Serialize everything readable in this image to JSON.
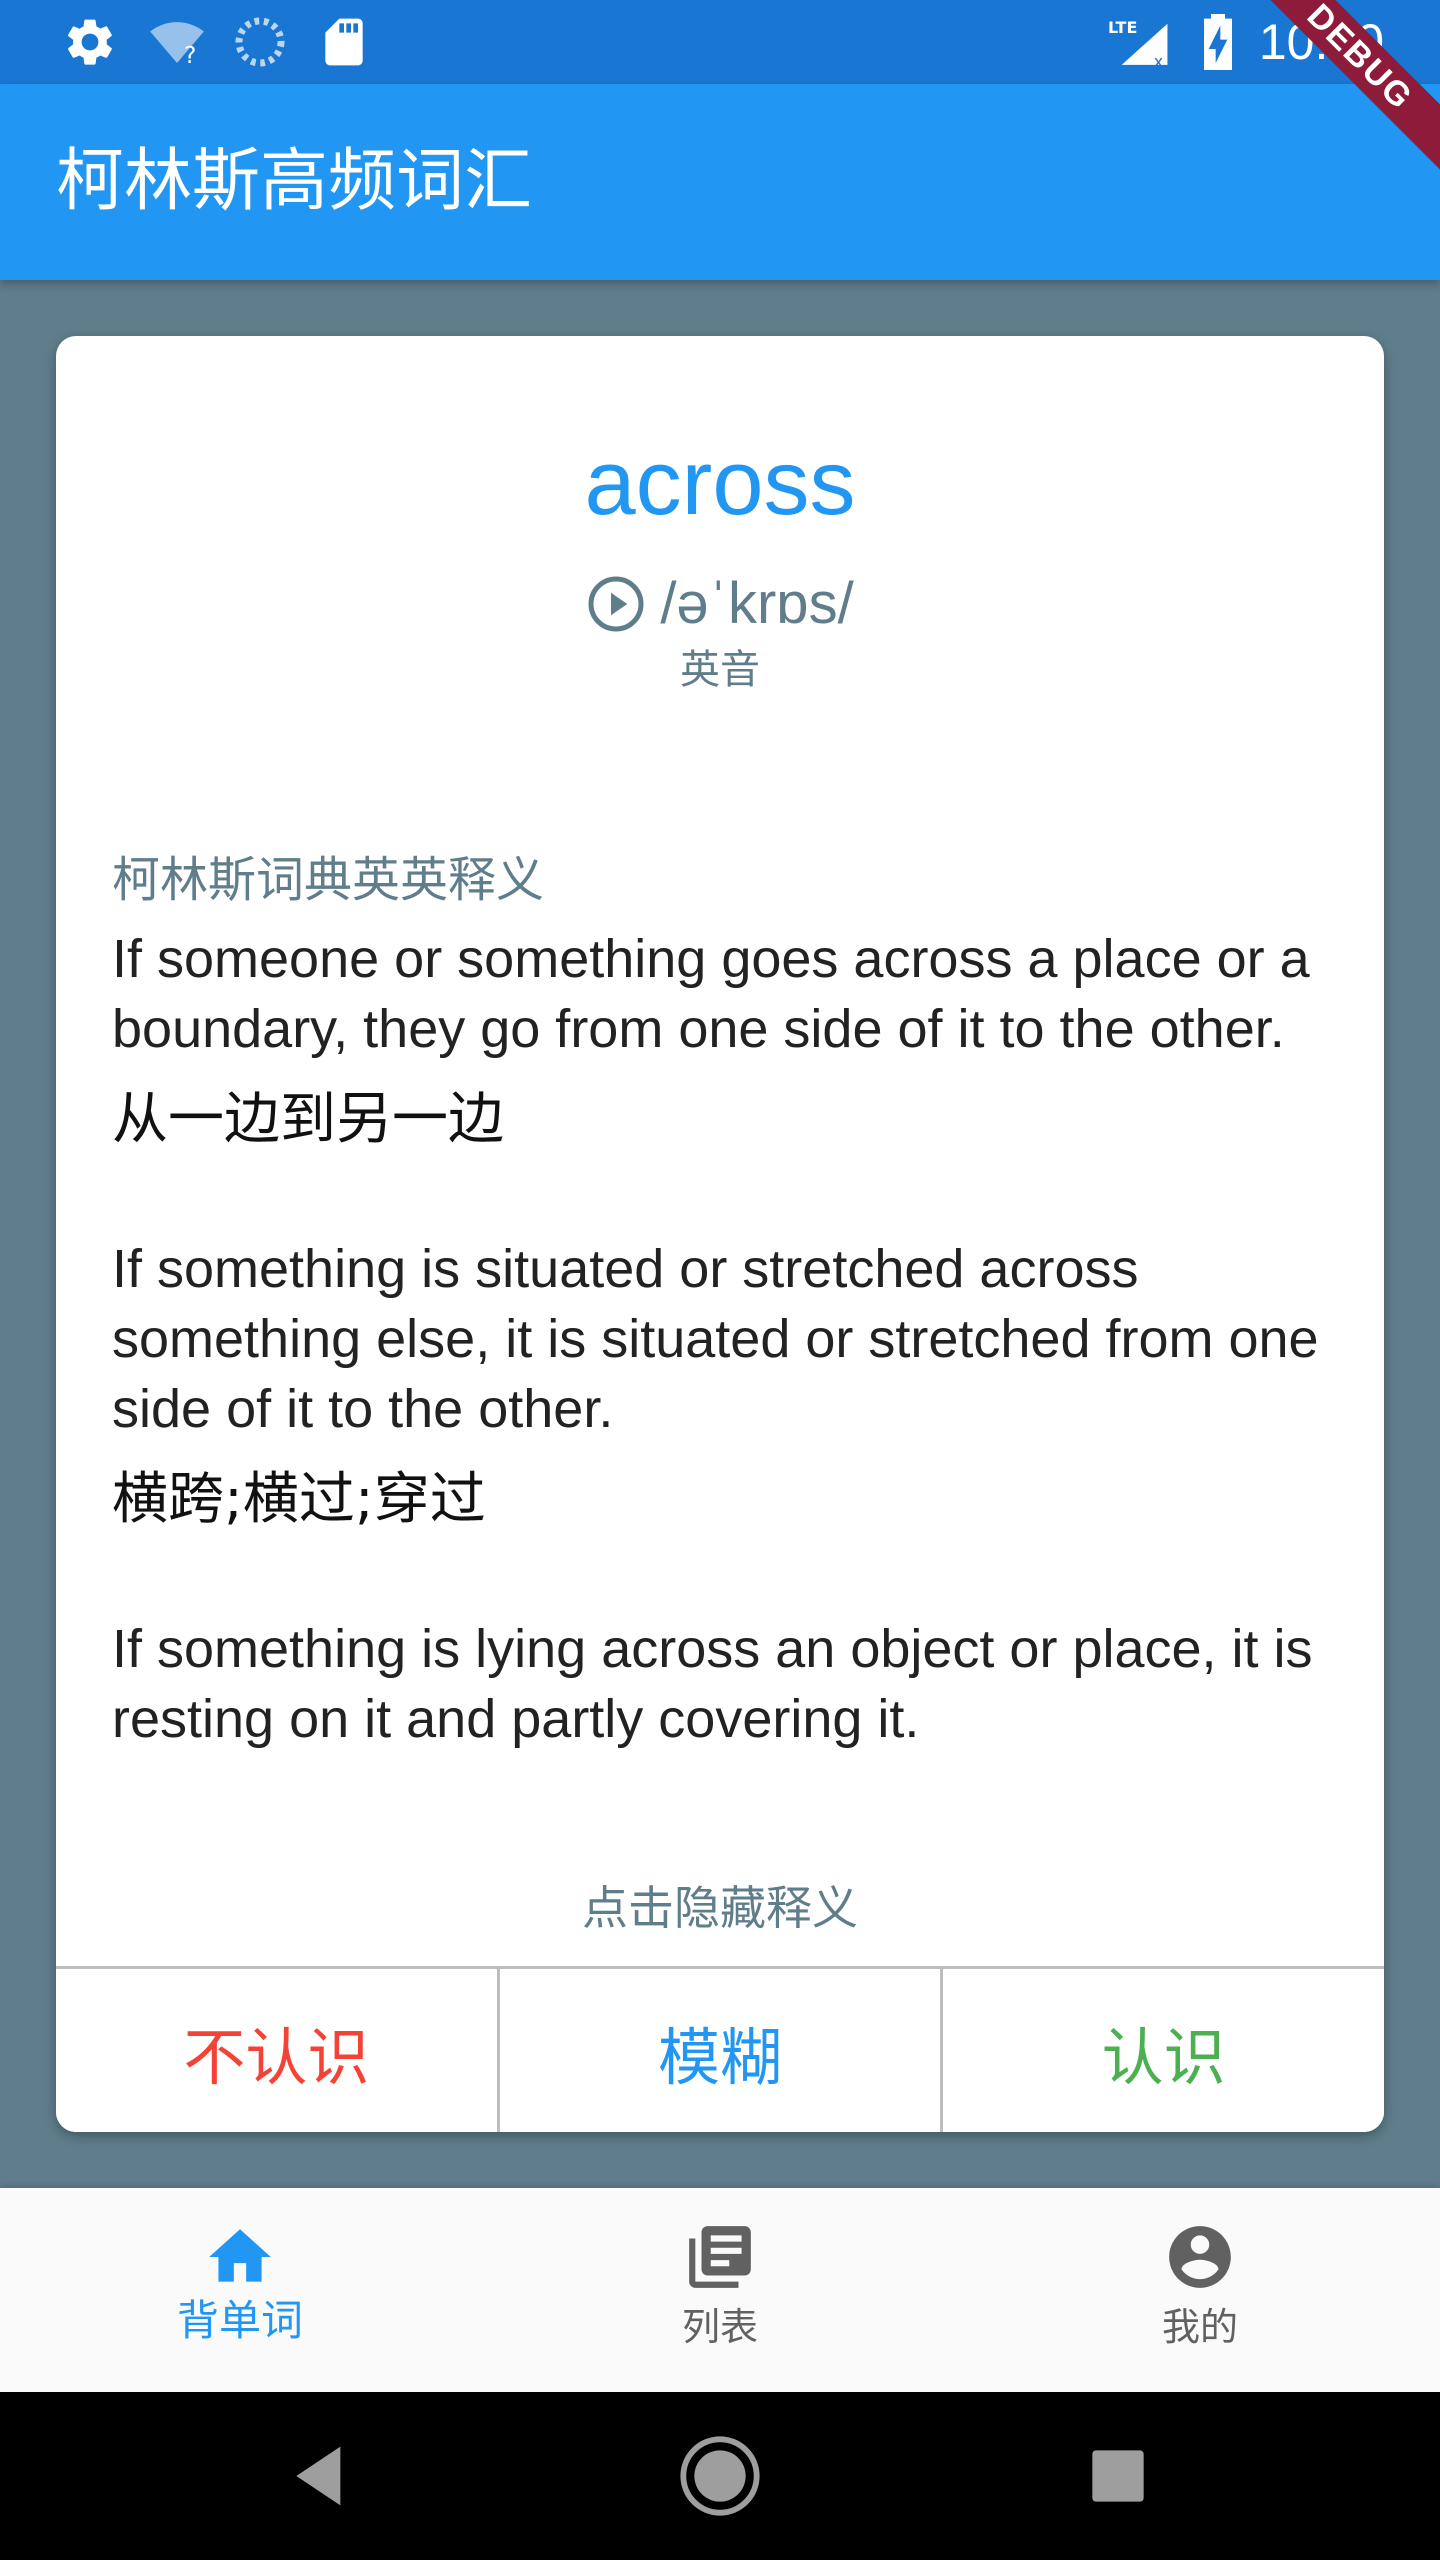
{
  "status_bar": {
    "time": "10:40",
    "icons": [
      "settings-icon",
      "wifi-unknown-icon",
      "loading-icon",
      "sd-card-icon",
      "lte-signal-icon",
      "battery-charging-icon"
    ],
    "color": "#1976D2"
  },
  "debug_banner": "DEBUG",
  "app_bar": {
    "title": "柯林斯高频词汇",
    "color": "#2196F3"
  },
  "card": {
    "word": "across",
    "phonetic": "/əˈkrɒs/",
    "accent": "英音",
    "section_title": "柯林斯词典英英释义",
    "definitions": [
      {
        "en": "If someone or something goes across a place or a boundary, they go from one side of it to the other.",
        "cn": "从一边到另一边"
      },
      {
        "en": "If something is situated or stretched across something else, it is situated or stretched from one side of it to the other.",
        "cn": "横跨;横过;穿过"
      },
      {
        "en": "If something is lying across an object or place, it is resting on it and partly covering it.",
        "cn": ""
      }
    ],
    "hint": "点击隐藏释义",
    "buttons": {
      "unknown": "不认识",
      "fuzzy": "模糊",
      "known": "认识"
    }
  },
  "bottom_nav": {
    "items": [
      {
        "label": "背单词",
        "icon": "home-icon",
        "active": true
      },
      {
        "label": "列表",
        "icon": "library-books-icon",
        "active": false
      },
      {
        "label": "我的",
        "icon": "account-circle-icon",
        "active": false
      }
    ],
    "active_color": "#2196F3"
  },
  "system_nav": {
    "icons": [
      "back-icon",
      "home-circle-icon",
      "recents-icon"
    ]
  }
}
